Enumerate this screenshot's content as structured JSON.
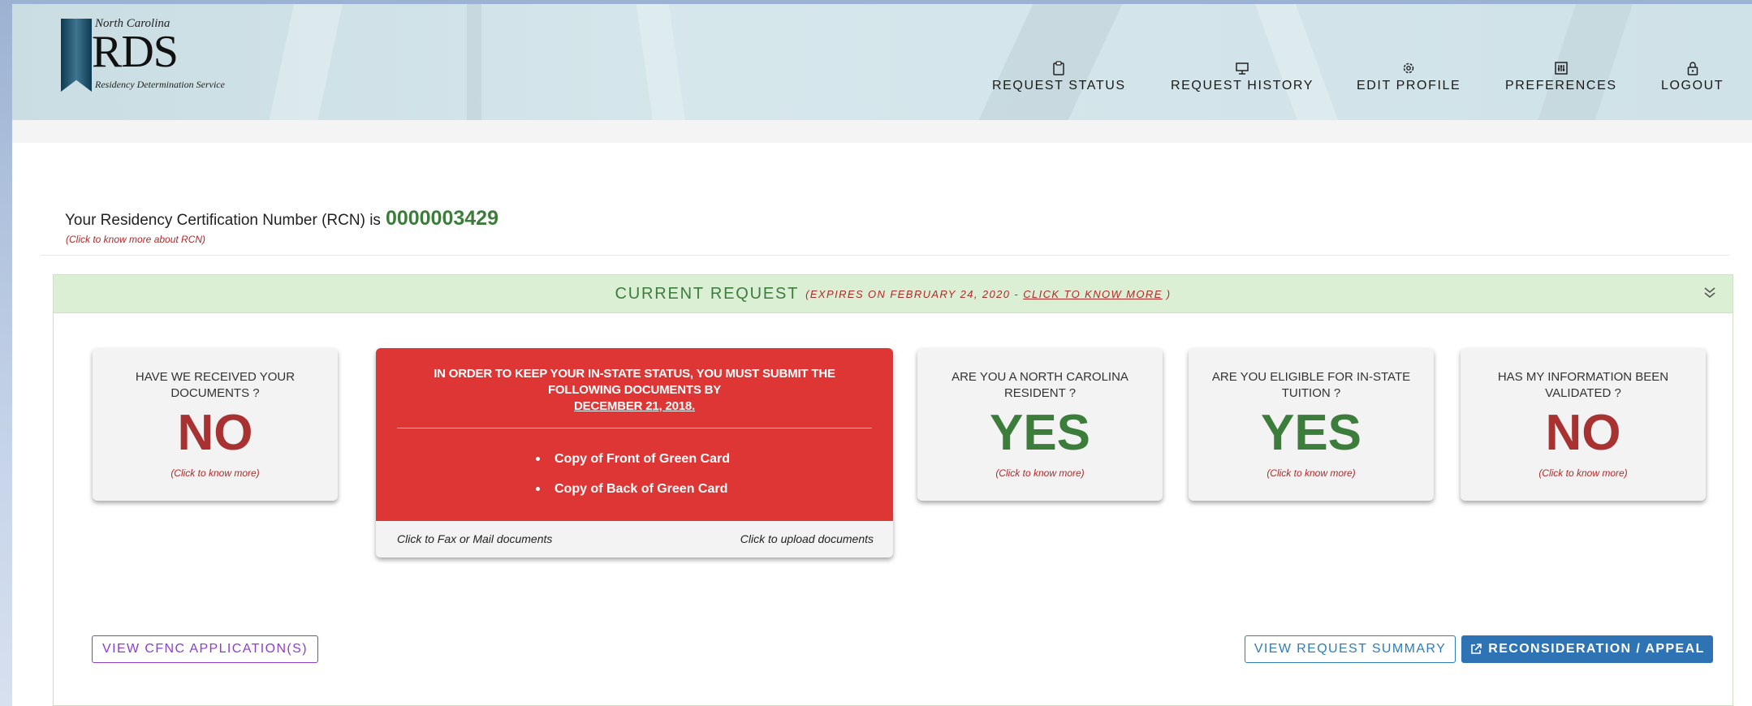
{
  "logo": {
    "state": "North Carolina",
    "acronym": "RDS",
    "service": "Residency Determination Service"
  },
  "nav": [
    {
      "label": "REQUEST STATUS",
      "icon": "clipboard-icon"
    },
    {
      "label": "REQUEST HISTORY",
      "icon": "presentation-icon"
    },
    {
      "label": "EDIT PROFILE",
      "icon": "gear-icon"
    },
    {
      "label": "PREFERENCES",
      "icon": "sliders-icon"
    },
    {
      "label": "LOGOUT",
      "icon": "lock-icon"
    }
  ],
  "rcn": {
    "label": "Your Residency Certification Number (RCN) is",
    "value": "0000003429",
    "more": "(Click to know more about RCN)"
  },
  "current_request": {
    "title": "CURRENT REQUEST",
    "expires_prefix": "(EXPIRES ON FEBRUARY 24, 2020 -",
    "expires_link": "CLICK TO KNOW MORE",
    "expires_suffix": ")"
  },
  "cards": [
    {
      "question": "HAVE WE RECEIVED YOUR DOCUMENTS ?",
      "answer": "NO",
      "more": "(Click to know more)"
    },
    {
      "question": "ARE YOU A NORTH CAROLINA RESIDENT ?",
      "answer": "YES",
      "more": "(Click to know more)"
    },
    {
      "question": "ARE YOU ELIGIBLE FOR IN-STATE TUITION ?",
      "answer": "YES",
      "more": "(Click to know more)"
    },
    {
      "question": "HAS MY INFORMATION BEEN VALIDATED ?",
      "answer": "NO",
      "more": "(Click to know more)"
    }
  ],
  "alert": {
    "message": "IN ORDER TO KEEP YOUR IN-STATE STATUS, YOU MUST SUBMIT THE FOLLOWING DOCUMENTS BY",
    "deadline": "DECEMBER 21, 2018.",
    "documents": [
      "Copy of Front of Green Card",
      "Copy of Back of Green Card"
    ],
    "fax_link": "Click to Fax or Mail documents",
    "upload_link": "Click to upload documents"
  },
  "buttons": {
    "cfnc": "VIEW CFNC APPLICATION(S)",
    "summary": "VIEW REQUEST SUMMARY",
    "appeal": "RECONSIDERATION / APPEAL"
  },
  "colors": {
    "yes": "#3c7d3c",
    "no": "#a83232",
    "alert": "#de3535",
    "primary": "#2e74b5",
    "purple": "#8d3ec8"
  }
}
